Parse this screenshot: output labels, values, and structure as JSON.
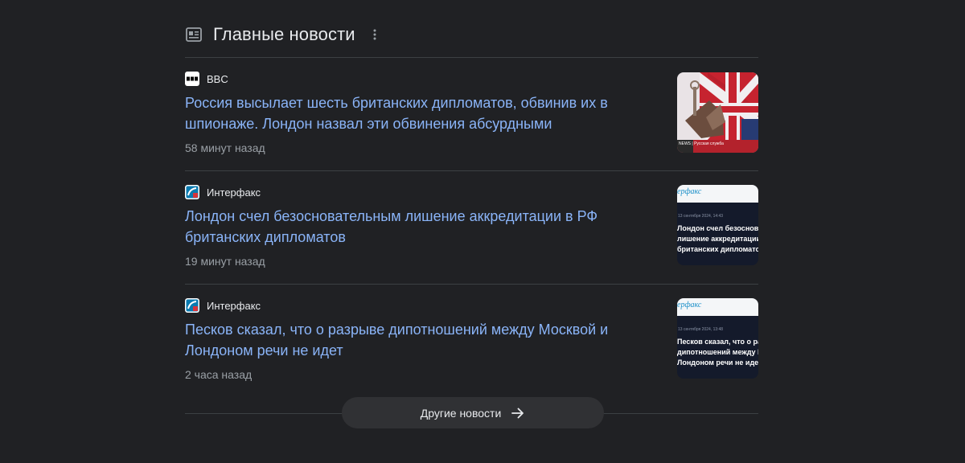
{
  "header": {
    "title": "Главные новости",
    "icon": "newspaper-icon",
    "menu_icon": "more-vert-icon"
  },
  "articles": [
    {
      "source": "BBC",
      "source_logo": "bbc-logo",
      "headline": "Россия высылает шесть британских дипломатов, обвинив их в шпионаже. Лондон назвал эти обвинения абсурдными",
      "time": "58 минут назад",
      "thumbnail": "uk-flag-news-thumbnail",
      "thumb_caption": "NEWS | Русская служба"
    },
    {
      "source": "Интерфакс",
      "source_logo": "interfax-logo",
      "headline": "Лондон счел безосновательным лишение аккредитации в РФ британских дипломатов",
      "time": "19 минут назад",
      "thumbnail": "interfax-card-thumbnail",
      "thumb_brand": "ерфакс",
      "thumb_date": "13 сентября 2024, 14:43",
      "thumb_lines": [
        "Лондон счел безоснова",
        "лишение аккредитации",
        "британских дипломатов"
      ]
    },
    {
      "source": "Интерфакс",
      "source_logo": "interfax-logo",
      "headline": "Песков сказал, что о разрыве дипотношений между Москвой и Лондоном речи не идет",
      "time": "2 часа назад",
      "thumbnail": "interfax-card-thumbnail",
      "thumb_brand": "ерфакс",
      "thumb_date": "13 сентября 2024, 13:48",
      "thumb_lines": [
        "Песков сказал, что о ра",
        "дипотношений между М",
        "Лондоном речи не идет"
      ]
    }
  ],
  "more_button": {
    "label": "Другие новости",
    "icon": "arrow-right-icon"
  },
  "colors": {
    "background": "#202124",
    "headline": "#8ab4f8",
    "muted": "#9aa0a6",
    "divider": "#3c4043",
    "button_bg": "#303134"
  }
}
